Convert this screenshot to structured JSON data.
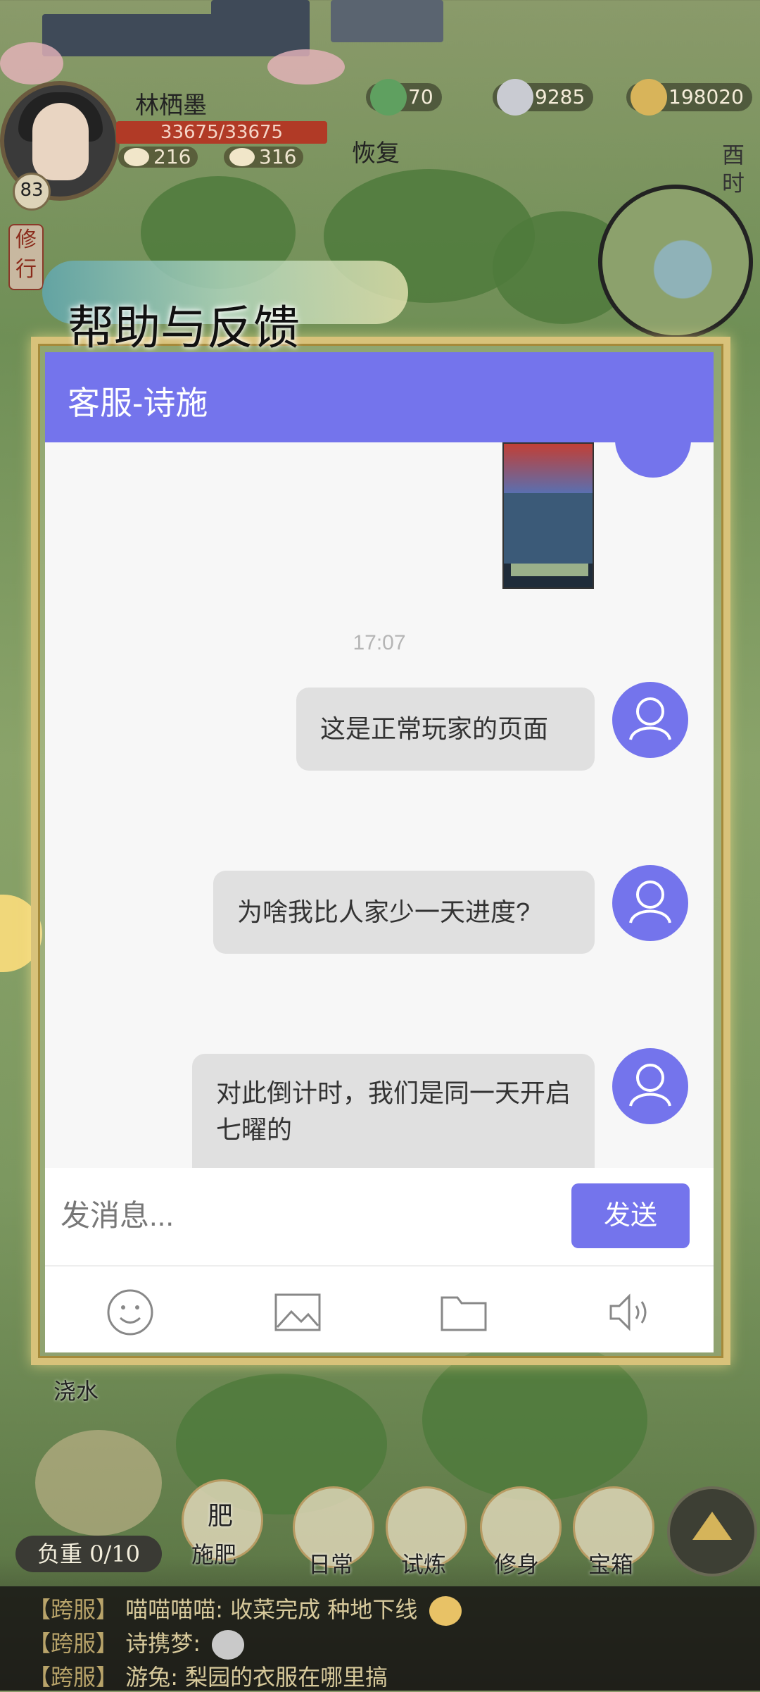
{
  "hud": {
    "player_name": "林栖墨",
    "level": "83",
    "hp": "33675/33675",
    "stat_a": "216",
    "stat_b": "316",
    "res_jade": "70",
    "res_silver": "9285",
    "res_coins": "198020",
    "recover_label": "恢复",
    "time_label": "酉时",
    "xiuxing_label": "修行"
  },
  "dialog": {
    "title": "帮助与反馈",
    "header": "客服-诗施",
    "timestamp": "17:07",
    "messages": [
      {
        "text": "这是正常玩家的页面"
      },
      {
        "text": "为啥我比人家少一天进度?"
      },
      {
        "text": "对此倒计时，我们是同一天开启七曜的"
      }
    ],
    "input_placeholder": "发消息...",
    "send_label": "发送",
    "tools": [
      "emoji-icon",
      "image-icon",
      "folder-icon",
      "voice-icon"
    ]
  },
  "bottom": {
    "watering_label": "浇水",
    "fertilize_label": "施肥",
    "fertilize_char": "肥",
    "daily_label": "日常",
    "trial_label": "试炼",
    "cultivate_label": "修身",
    "chest_label": "宝箱",
    "burden": "负重 0/10"
  },
  "chat_log": [
    {
      "channel": "【跨服】",
      "text": "喵喵喵喵: 收菜完成 种地下线",
      "emoji": "laugh-emoji"
    },
    {
      "channel": "【跨服】",
      "text": "诗携梦:",
      "emoji": "grumpy-emoji"
    },
    {
      "channel": "【跨服】",
      "text": "游兔: 梨园的衣服在哪里搞"
    }
  ],
  "colors": {
    "accent": "#7474ec",
    "frame_gold": "#d8c27a",
    "bubble": "#e0e0e0",
    "hp_red": "#b13a26"
  }
}
